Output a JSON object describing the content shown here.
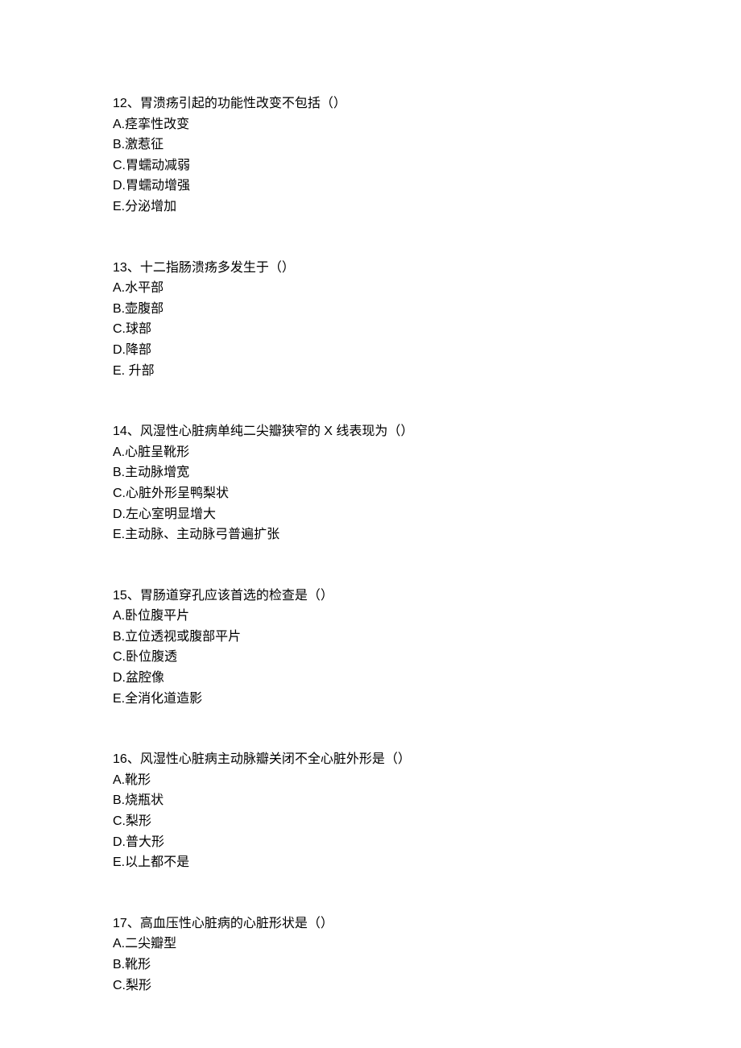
{
  "questions": [
    {
      "number": "12、",
      "text": "胃溃疡引起的功能性改变不包括（）",
      "options": [
        "A.痉挛性改变",
        "B.激惹征",
        "C.胃蠕动减弱",
        "D.胃蠕动增强",
        "E.分泌增加"
      ]
    },
    {
      "number": "13、",
      "text": "十二指肠溃疡多发生于（）",
      "options": [
        "A.水平部",
        "B.壶腹部",
        "C.球部",
        "D.降部",
        "E. 升部"
      ]
    },
    {
      "number": "14、",
      "text": "风湿性心脏病单纯二尖瓣狭窄的 X 线表现为（）",
      "options": [
        "A.心脏呈靴形",
        "B.主动脉增宽",
        "C.心脏外形呈鸭梨状",
        "D.左心室明显增大",
        "E.主动脉、主动脉弓普遍扩张"
      ]
    },
    {
      "number": "15、",
      "text": "胃肠道穿孔应该首选的检查是（）",
      "options": [
        "A.卧位腹平片",
        "B.立位透视或腹部平片",
        "C.卧位腹透",
        "D.盆腔像",
        "E.全消化道造影"
      ]
    },
    {
      "number": "16、",
      "text": "风湿性心脏病主动脉瓣关闭不全心脏外形是（）",
      "options": [
        "A.靴形",
        "B.烧瓶状",
        "C.梨形",
        "D.普大形",
        "E.以上都不是"
      ]
    },
    {
      "number": "17、",
      "text": "高血压性心脏病的心脏形状是（）",
      "options": [
        "A.二尖瓣型",
        "B.靴形",
        "C.梨形"
      ]
    }
  ]
}
